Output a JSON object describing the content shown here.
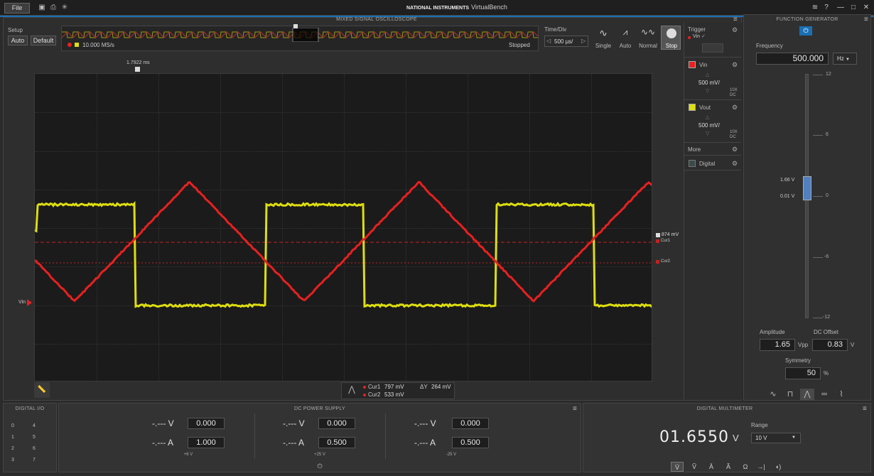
{
  "titlebar": {
    "file": "File",
    "brand_logo": "NATIONAL INSTRUMENTS",
    "brand": "VirtualBench"
  },
  "scope": {
    "title": "MIXED SIGNAL OSCILLOSCOPE",
    "setup_label": "Setup",
    "auto_btn": "Auto",
    "default_btn": "Default",
    "sample_rate": "10.000 MS/s",
    "status": "Stopped",
    "timediv_label": "Time/Div",
    "timediv_value": "500 µs/",
    "modes": [
      "Single",
      "Auto",
      "Normal",
      "Stop"
    ],
    "trigger_time": "1.7922 ms",
    "trigger_level": "874 mV",
    "cur1_label": "Cur1",
    "cur2_label": "Cur2",
    "vin_marker": "Vin",
    "readout": {
      "cur1": "Cur1",
      "cur1_val": "797  mV",
      "cur2": "Cur2",
      "cur2_val": "533  mV",
      "dy": "ΔY",
      "dy_val": "264  mV"
    },
    "colors": {
      "vin": "#e82020",
      "vout": "#dede10"
    }
  },
  "side": {
    "trigger_title": "Trigger",
    "trigger_src": "Vin",
    "ch1": {
      "name": "Vin",
      "scale": "500 mV/",
      "probe": "10X",
      "coupling": "DC"
    },
    "ch2": {
      "name": "Vout",
      "scale": "500 mV/",
      "probe": "10X",
      "coupling": "DC"
    },
    "more": "More",
    "digital": "Digital"
  },
  "fgen": {
    "title": "FUNCTION GENERATOR",
    "frequency_label": "Frequency",
    "frequency": "500.000",
    "unit": "Hz",
    "scale_ticks": [
      "12",
      "6",
      "0",
      "-6",
      "-12"
    ],
    "marker_high": "1.66 V",
    "marker_low": "0.01 V",
    "amplitude_label": "Amplitude",
    "amplitude": "1.65",
    "amplitude_unit": "Vpp",
    "offset_label": "DC Offset",
    "offset": "0.83",
    "offset_unit": "V",
    "symmetry_label": "Symmetry",
    "symmetry": "50",
    "symmetry_unit": "%"
  },
  "digital_io": {
    "title": "DIGITAL I/O",
    "left": [
      "0",
      "1",
      "2",
      "3"
    ],
    "right": [
      "4",
      "5",
      "6",
      "7"
    ]
  },
  "psu": {
    "title": "DC POWER SUPPLY",
    "channels": [
      {
        "v_disp": "-.--- V",
        "v_set": "0.000",
        "a_disp": "-.--- A",
        "a_set": "1.000",
        "label": "+6 V"
      },
      {
        "v_disp": "-.--- V",
        "v_set": "0.000",
        "a_disp": "-.--- A",
        "a_set": "0.500",
        "label": "+25 V"
      },
      {
        "v_disp": "-.--- V",
        "v_set": "0.000",
        "a_disp": "-.--- A",
        "a_set": "0.500",
        "label": "-25 V"
      }
    ]
  },
  "dmm": {
    "title": "DIGITAL MULTIMETER",
    "reading": "01.6550",
    "unit": "V",
    "range_label": "Range",
    "range": "10 V"
  }
}
